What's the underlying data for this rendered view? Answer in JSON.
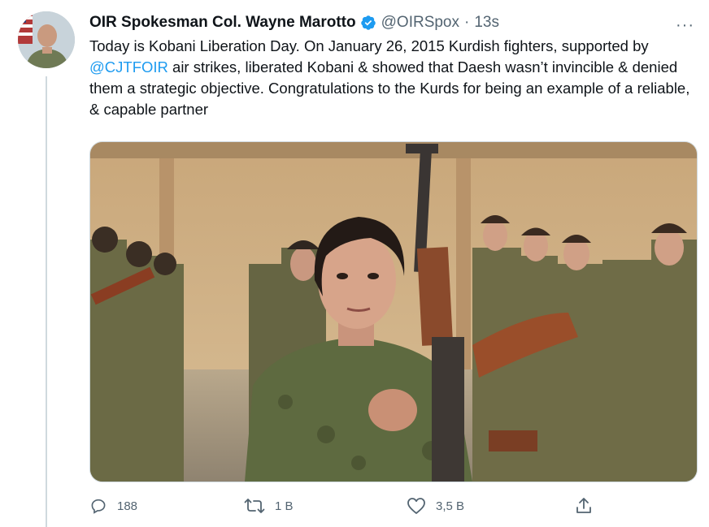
{
  "tweet": {
    "display_name": "OIR Spokesman Col. Wayne Marotto",
    "handle": "@OIRSpox",
    "separator": "·",
    "time": "13s",
    "more": "···",
    "text_part1": "Today is Kobani Liberation Day. On January 26, 2015 Kurdish fighters, supported by ",
    "mention": "@CJTFOIR",
    "text_part2": " air strikes, liberated  Kobani & showed that Daesh wasn’t invincible & denied them a strategic objective. Congratulations to the Kurds for being an example of a reliable, & capable partner"
  },
  "actions": {
    "replies": "188",
    "retweets": "1 В",
    "likes": "3,5 В"
  },
  "icons": {
    "avatar": "avatar",
    "verified": "verified-badge-icon",
    "reply": "reply-icon",
    "retweet": "retweet-icon",
    "like": "heart-icon",
    "share": "share-icon"
  },
  "colors": {
    "accent": "#1d9bf0",
    "secondary_text": "#536471",
    "primary_text": "#0f1419"
  }
}
